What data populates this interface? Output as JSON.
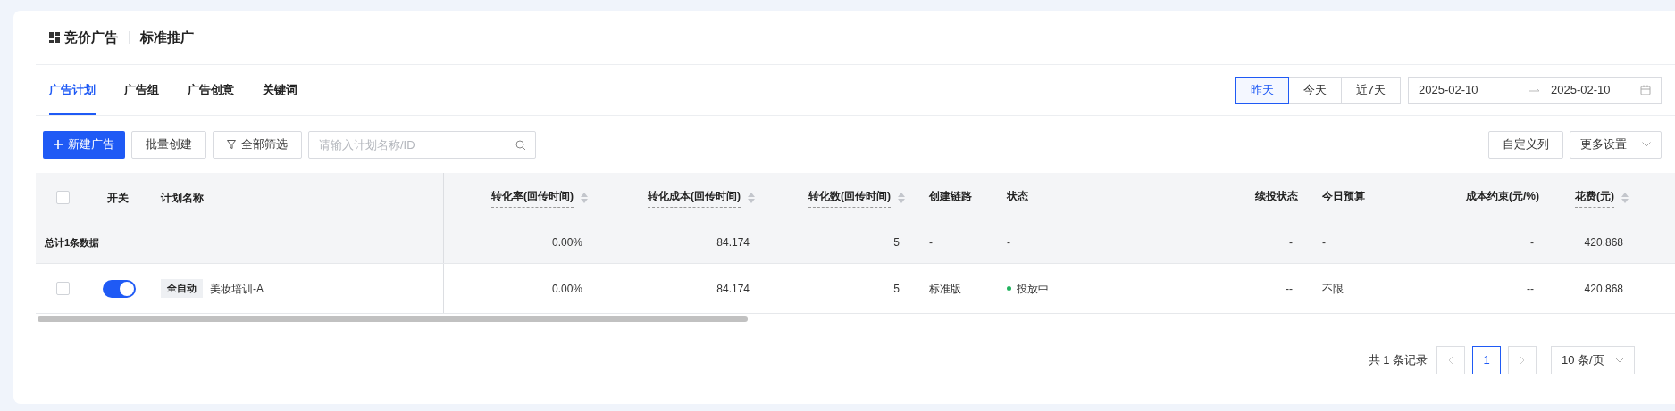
{
  "header": {
    "title": "竞价广告",
    "subtitle": "标准推广"
  },
  "tabs": [
    {
      "label": "广告计划",
      "selected": true
    },
    {
      "label": "广告组",
      "selected": false
    },
    {
      "label": "广告创意",
      "selected": false
    },
    {
      "label": "关键词",
      "selected": false
    }
  ],
  "date_presets": [
    {
      "label": "昨天",
      "selected": true
    },
    {
      "label": "今天",
      "selected": false
    },
    {
      "label": "近7天",
      "selected": false
    }
  ],
  "date_range": {
    "start": "2025-02-10",
    "end": "2025-02-10"
  },
  "toolbar": {
    "create_button": "新建广告",
    "batch_button": "批量创建",
    "filter_button": "全部筛选",
    "search_placeholder": "请输入计划名称/ID",
    "columns_button": "自定义列",
    "more_select": "更多设置"
  },
  "table": {
    "select_all_checked": false,
    "fixed_columns": [
      "开关",
      "计划名称"
    ],
    "columns": [
      {
        "label": "转化率(回传时间)",
        "sortable": true
      },
      {
        "label": "转化成本(回传时间)",
        "sortable": true
      },
      {
        "label": "转化数(回传时间)",
        "sortable": true
      },
      {
        "label": "创建链路",
        "sortable": false
      },
      {
        "label": "状态",
        "sortable": false
      },
      {
        "label": "续投状态",
        "sortable": false
      },
      {
        "label": "今日预算",
        "sortable": false
      },
      {
        "label": "成本约束(元/%)",
        "sortable": false
      },
      {
        "label": "花费(元)",
        "sortable": true
      }
    ],
    "summary": {
      "label": "总计1条数据",
      "cells": [
        {
          "text": "0.00%"
        },
        {
          "text": "84.174"
        },
        {
          "text": "5"
        },
        {
          "text": "-"
        },
        {
          "text": "-"
        },
        {
          "text": "-"
        },
        {
          "text": "-"
        },
        {
          "text": "-"
        },
        {
          "text": "420.868"
        }
      ]
    },
    "rows": [
      {
        "checked": false,
        "on": true,
        "tag": "全自动",
        "name": "美妆培训-A",
        "cells": [
          {
            "text": "0.00%"
          },
          {
            "text": "84.174"
          },
          {
            "text": "5"
          },
          {
            "text": "标准版"
          },
          {
            "text": "投放中",
            "color": "#22b35e"
          },
          {
            "text": "--"
          },
          {
            "text": "不限"
          },
          {
            "text": "--"
          },
          {
            "text": "420.868"
          }
        ]
      }
    ]
  },
  "pagination": {
    "total": "共 1 条记录",
    "prev_disabled": true,
    "next_disabled": true,
    "pages": [
      {
        "label": "1",
        "selected": true
      }
    ],
    "page_size": "10 条/页"
  }
}
